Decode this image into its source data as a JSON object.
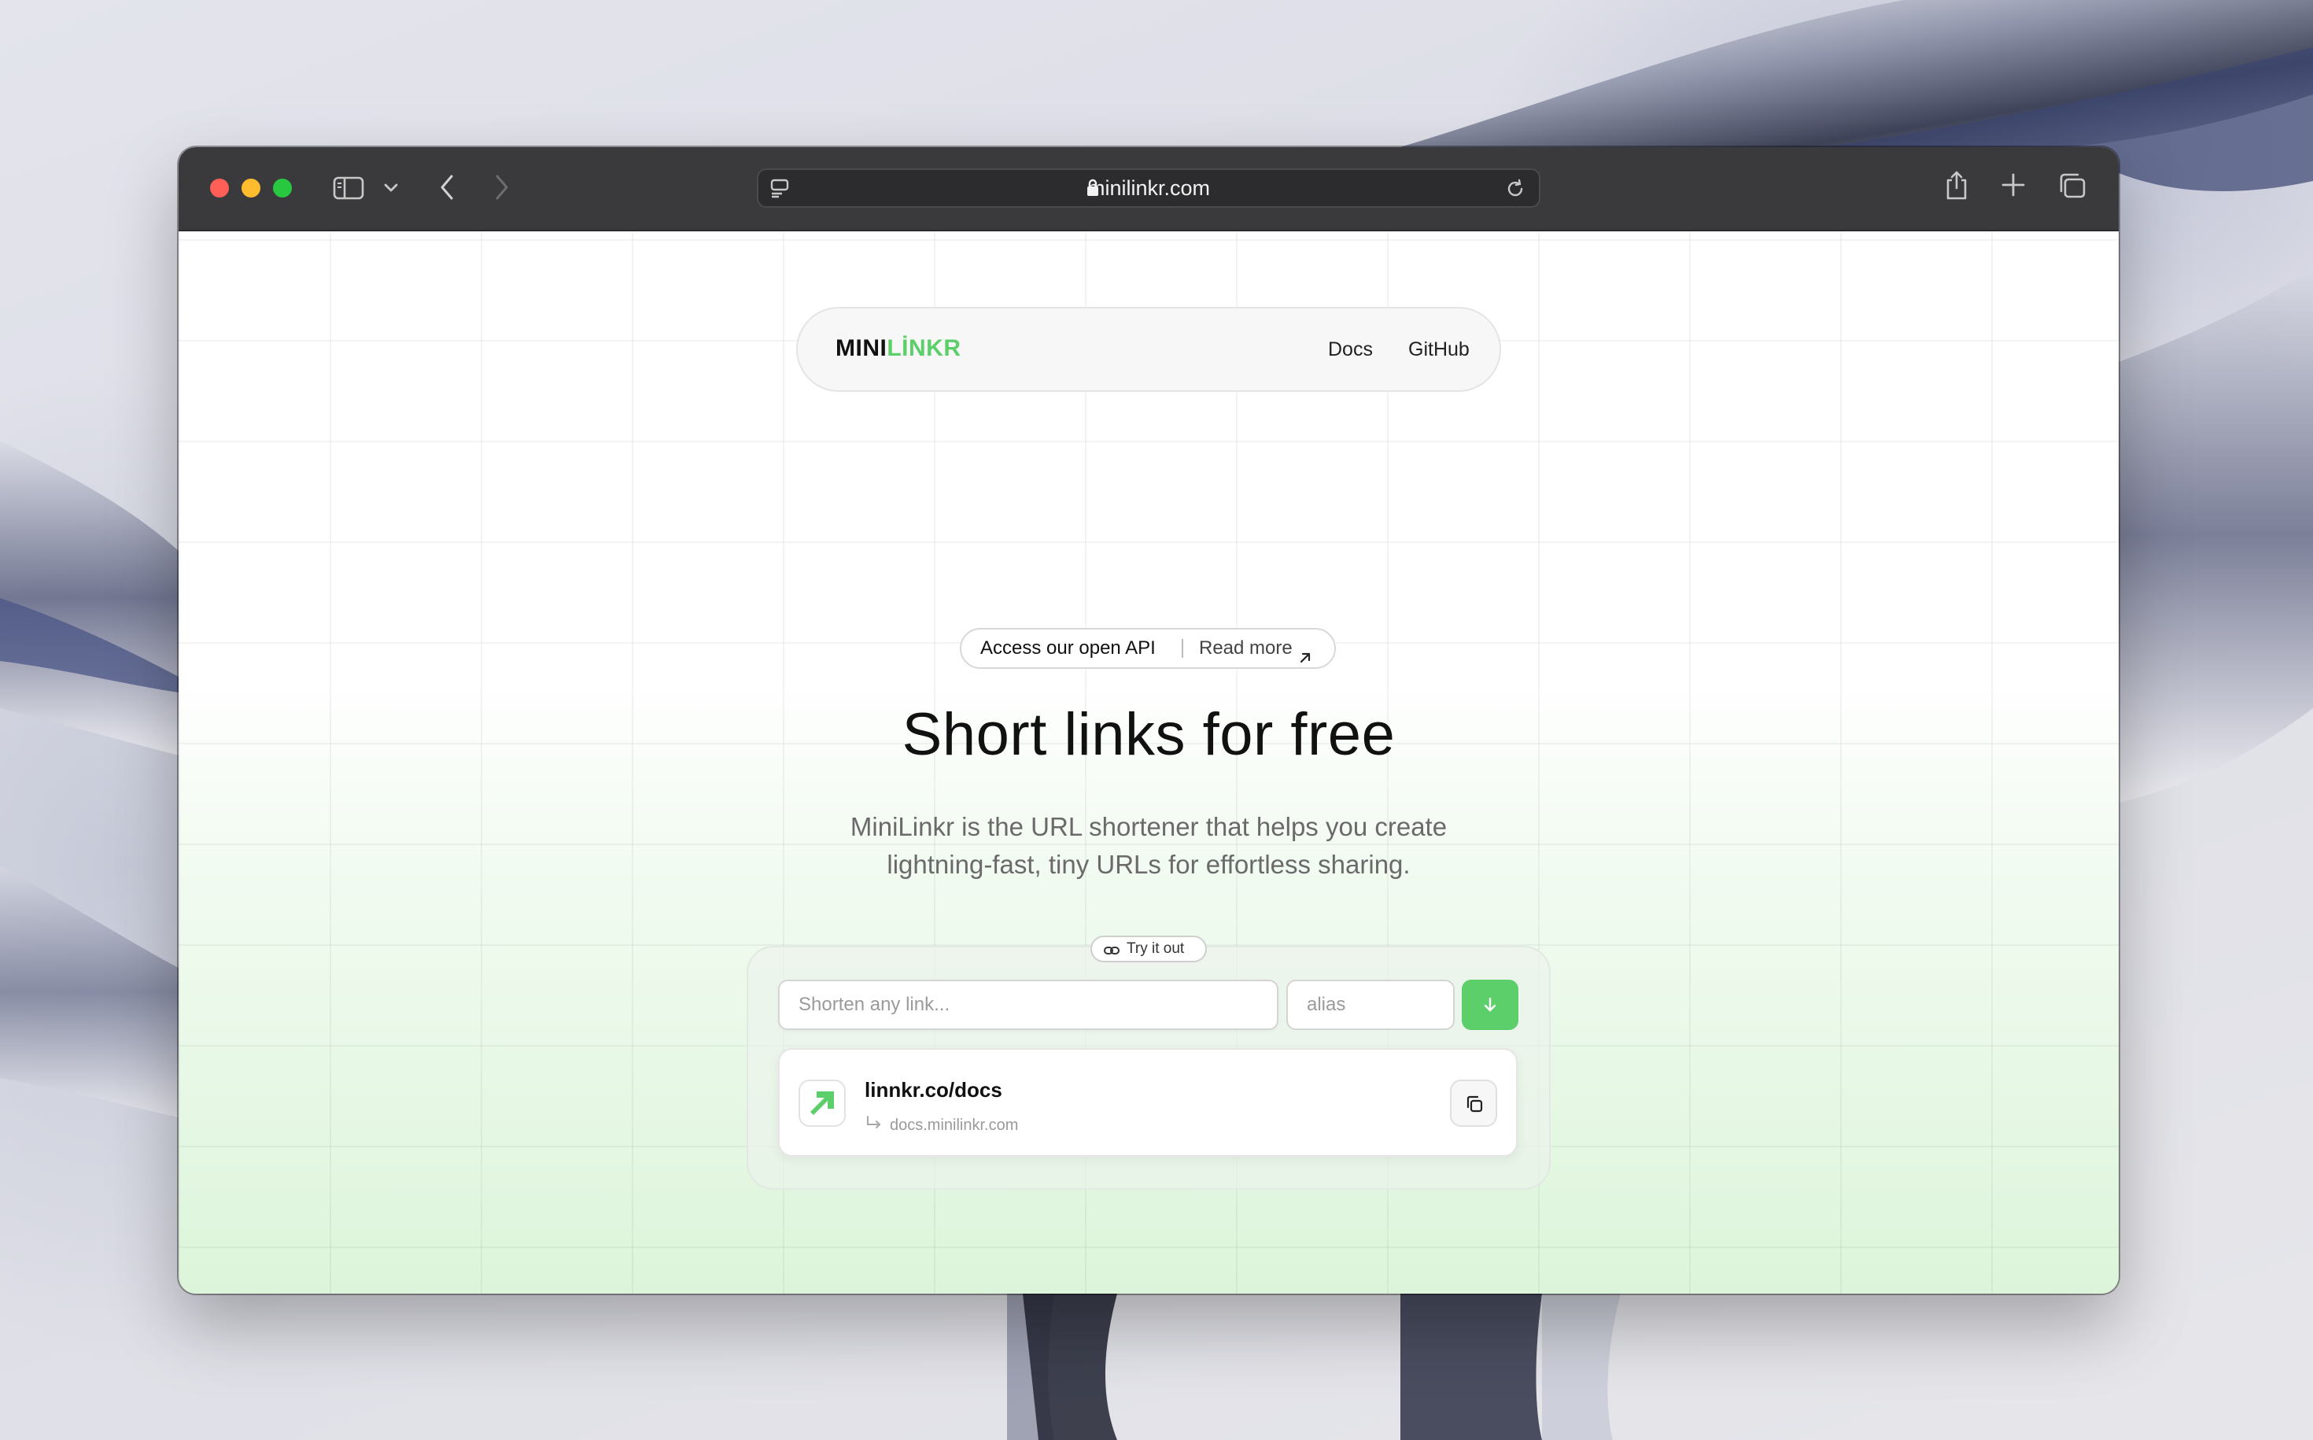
{
  "browser": {
    "url": "minilinkr.com",
    "icons": [
      "sidebar-icon",
      "chevron-down-icon",
      "back-icon",
      "forward-icon",
      "reader-icon",
      "lock-icon",
      "reload-icon",
      "share-icon",
      "new-tab-icon",
      "tabs-icon"
    ]
  },
  "nav": {
    "brand_part1": "MINI",
    "brand_part2": "LİNKR",
    "docs_label": "Docs",
    "github_label": "GitHub"
  },
  "announcement": {
    "text": "Access our open API",
    "link_label": "Read more"
  },
  "hero": {
    "title": "Short links for free",
    "subtitle": "MiniLinkr is the URL shortener that helps you create lightning-fast, tiny URLs for effortless sharing."
  },
  "try_it": {
    "badge_label": "Try it out",
    "link_placeholder": "Shorten any link...",
    "alias_placeholder": "alias"
  },
  "result": {
    "short_url": "linnkr.co/docs",
    "original_url": "docs.minilinkr.com"
  },
  "colors": {
    "accent": "#5ccf6b",
    "toolbar": "#3a3a3c"
  }
}
